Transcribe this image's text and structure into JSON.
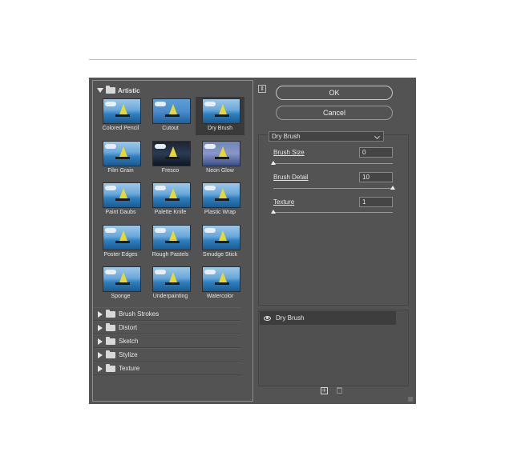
{
  "gallery": {
    "category_open": "Artistic",
    "thumbnails": [
      {
        "label": "Colored Pencil"
      },
      {
        "label": "Cutout"
      },
      {
        "label": "Dry Brush",
        "selected": true
      },
      {
        "label": "Film Grain"
      },
      {
        "label": "Fresco"
      },
      {
        "label": "Neon Glow"
      },
      {
        "label": "Paint Daubs"
      },
      {
        "label": "Palette Knife"
      },
      {
        "label": "Plastic Wrap"
      },
      {
        "label": "Poster Edges"
      },
      {
        "label": "Rough Pastels"
      },
      {
        "label": "Smudge Stick"
      },
      {
        "label": "Sponge"
      },
      {
        "label": "Underpainting"
      },
      {
        "label": "Watercolor"
      }
    ],
    "subcategories": [
      "Brush Strokes",
      "Distort",
      "Sketch",
      "Stylize",
      "Texture"
    ]
  },
  "buttons": {
    "ok": "OK",
    "cancel": "Cancel"
  },
  "filter_select": {
    "value": "Dry Brush"
  },
  "params": [
    {
      "label": "Brush Size",
      "value": "0",
      "fraction": 0.0
    },
    {
      "label": "Brush Detail",
      "value": "10",
      "fraction": 1.0
    },
    {
      "label": "Texture",
      "value": "1",
      "fraction": 0.0
    }
  ],
  "layers": [
    {
      "name": "Dry Brush",
      "visible": true
    }
  ],
  "icons": {
    "collapse": "collapse-icon",
    "eye": "eye-icon",
    "new_layer": "new-effect-layer-icon",
    "delete": "trash-icon"
  }
}
